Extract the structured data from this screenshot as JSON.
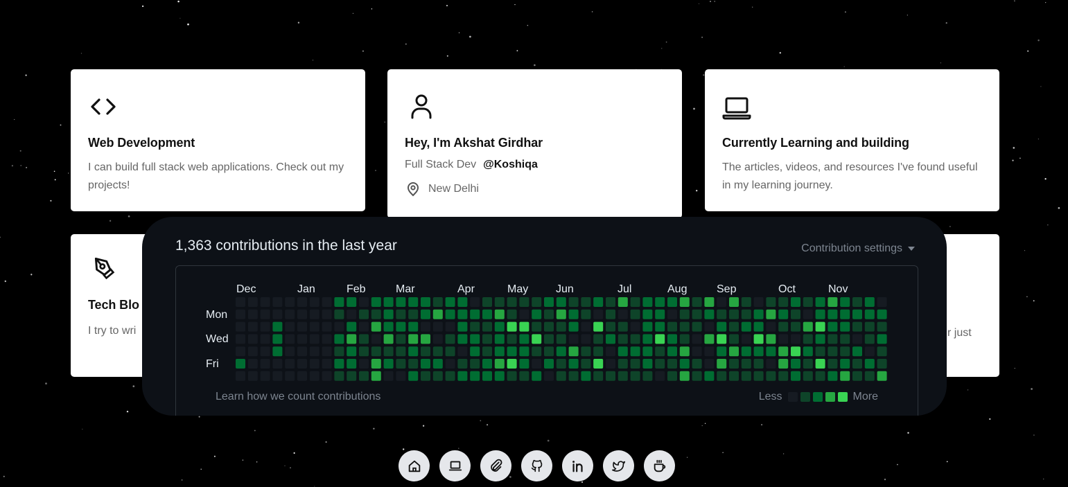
{
  "cards": [
    {
      "id": "web-dev",
      "icon": "code-brackets-icon",
      "title": "Web Development",
      "desc": "I can build full stack web applications. Check out my projects!"
    },
    {
      "id": "about",
      "icon": "user-icon",
      "title": "Hey, I'm Akshat Girdhar",
      "role": "Full Stack Dev",
      "handle": "@Koshiqa",
      "location": "New Delhi",
      "location_icon": "map-pin-icon"
    },
    {
      "id": "learning",
      "icon": "laptop-icon",
      "title": "Currently Learning and building",
      "desc": "The articles, videos, and resources I've found useful in my learning journey."
    },
    {
      "id": "tech-blog",
      "icon": "pen-tool-icon",
      "title": "Tech Blo",
      "desc": "I try to wri"
    },
    {
      "id": "partial-right",
      "desc": "r just"
    }
  ],
  "contributions": {
    "title": "1,363 contributions in the last year",
    "settings_label": "Contribution settings",
    "settings_icon": "caret-down-icon",
    "months": [
      "Dec",
      "Jan",
      "Feb",
      "Mar",
      "Apr",
      "May",
      "Jun",
      "Jul",
      "Aug",
      "Sep",
      "Oct",
      "Nov"
    ],
    "days": [
      "Mon",
      "Wed",
      "Fri"
    ],
    "learn_link": "Learn how we count contributions",
    "legend_less": "Less",
    "legend_more": "More",
    "colors": [
      "#161b22",
      "#0e4429",
      "#006d32",
      "#26a641",
      "#39d353"
    ]
  },
  "dock": [
    {
      "name": "home-icon"
    },
    {
      "name": "laptop-icon"
    },
    {
      "name": "paperclip-icon"
    },
    {
      "name": "github-icon"
    },
    {
      "name": "linkedin-icon"
    },
    {
      "name": "twitter-icon"
    },
    {
      "name": "coffee-icon"
    }
  ]
}
